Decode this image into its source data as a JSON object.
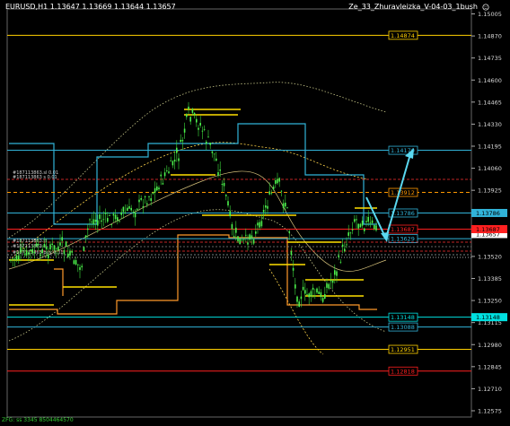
{
  "header": {
    "symbol_info": "EURUSD,H1  1.13647 1.13669 1.13644 1.13657",
    "indicator_name": "Ze_33_Zhuravleizka_V-04-03_1bush",
    "indicator_icon": "smiley-icon"
  },
  "axis": {
    "ticks": [
      "1.15005",
      "1.14870",
      "1.14735",
      "1.14600",
      "1.14465",
      "1.14330",
      "1.14195",
      "1.14060",
      "1.13925",
      "1.13790",
      "1.13655",
      "1.13520",
      "1.13385",
      "1.13250",
      "1.13115",
      "1.12980",
      "1.12845",
      "1.12710",
      "1.12575"
    ],
    "current_price_label": "1.13657",
    "current_price_color": "#ffffff"
  },
  "levels": [
    {
      "label": "1.14874",
      "color": "#ffd000"
    },
    {
      "label": "1.14170",
      "color": "#31b3d8"
    },
    {
      "label": "1.13912",
      "color": "#ff9900"
    },
    {
      "label": "1.13786",
      "color": "#31b3d8"
    },
    {
      "label": "1.13687",
      "color": "#ff2020"
    },
    {
      "label": "1.13629",
      "color": "#31b3d8"
    },
    {
      "label": "1.13148",
      "color": "#00e0e0"
    },
    {
      "label": "1.13088",
      "color": "#31b3d8"
    },
    {
      "label": "1.12951",
      "color": "#ffd000"
    },
    {
      "label": "1.12818",
      "color": "#ff2020"
    }
  ],
  "order_labels": [
    "#187113863.sl 0.01",
    "#187113863 s 0.01",
    "#187113863.tt",
    "#187113863 sl",
    "#187113863 buy 0.01"
  ],
  "status_text": "ZFG: ss 3345 8504464570"
}
